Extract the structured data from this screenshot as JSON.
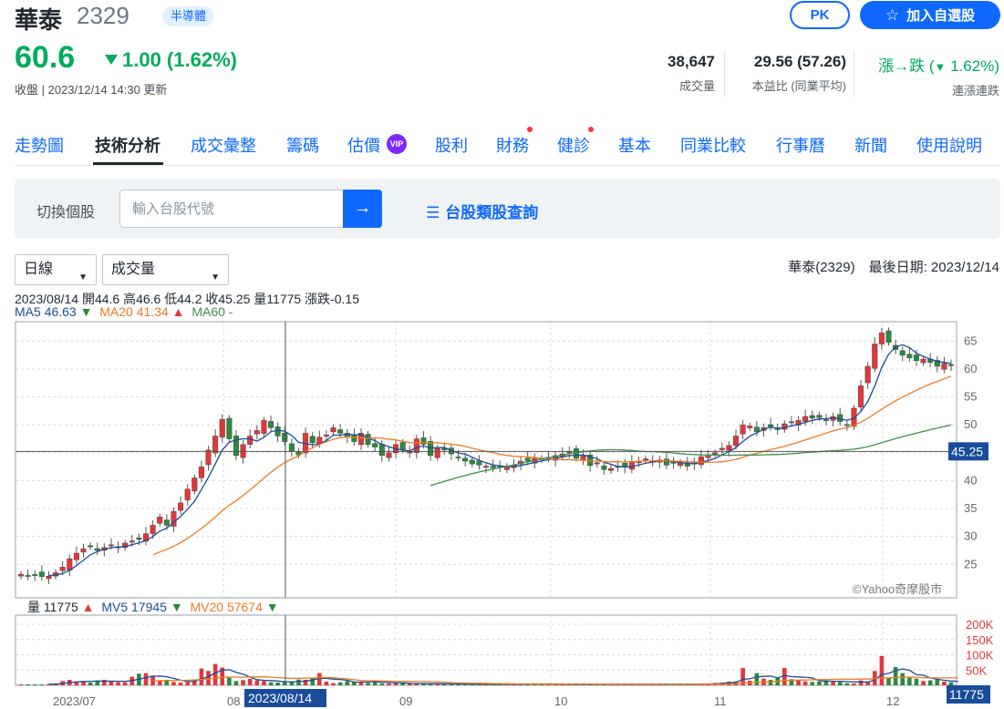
{
  "header": {
    "stock_name": "華泰",
    "stock_code": "2329",
    "industry": "半導體",
    "price": "60.6",
    "change": "1.00 (1.62%)",
    "close_time": "收盤 | 2023/12/14 14:30 更新",
    "pk_label": "PK",
    "watchlist_label": "加入自選股",
    "stats": [
      {
        "value": "38,647",
        "label": "成交量"
      },
      {
        "value": "29.56 (57.26)",
        "label": "本益比 (同業平均)"
      },
      {
        "value": "漲→跌 (",
        "value2": "1.62%)",
        "label": "連漲連跌"
      }
    ]
  },
  "tabs": [
    "走勢圖",
    "技術分析",
    "成交彙整",
    "籌碼",
    "估價",
    "股利",
    "財務",
    "健診",
    "基本",
    "同業比較",
    "行事曆",
    "新聞",
    "使用說明"
  ],
  "vip_label": "VIP",
  "switch": {
    "label": "切換個股",
    "placeholder": "輸入台股代號",
    "go_icon": "→",
    "category_link": "台股類股查詢"
  },
  "selects": {
    "period": "日線",
    "indicator": "成交量"
  },
  "chart_meta": "華泰(2329)　最後日期: 2023/12/14",
  "ohlc_info": "2023/08/14 開44.6 高46.6 低44.2 收45.25 量11775 漲跌-0.15",
  "ma_info": {
    "ma5_label": "MA5",
    "ma5_value": "46.63",
    "ma5_dir": "▼",
    "ma20_label": "MA20",
    "ma20_value": "41.34",
    "ma20_dir": "▲",
    "ma60_label": "MA60",
    "ma60_value": "-"
  },
  "vol_info": {
    "vol_label": "量",
    "vol_value": "11775",
    "vol_dir": "▲",
    "mv5_label": "MV5",
    "mv5_value": "17945",
    "mv5_dir": "▼",
    "mv20_label": "MV20",
    "mv20_value": "57674",
    "mv20_dir": "▼"
  },
  "colors": {
    "up": "#e0383a",
    "down": "#2b8a3e",
    "ma5": "#1a4c9c",
    "ma20": "#ef7a20",
    "ma60": "#3e8f4d",
    "accent": "#0f69ff"
  },
  "chart_data": {
    "type": "candlestick",
    "price_yticks": [
      25,
      30,
      35,
      40,
      45,
      50,
      55,
      60,
      65
    ],
    "volume_yticks": [
      "50K",
      "100K",
      "150K",
      "200K"
    ],
    "x_ticks": [
      "2023/07",
      "08",
      "09",
      "10",
      "11",
      "12"
    ],
    "crosshair_date": "2023/08/14",
    "crosshair_price": "45.25",
    "crosshair_volume": "11775",
    "watermark": "©Yahoo奇摩股市",
    "close": [
      23.2,
      23.0,
      23.1,
      22.8,
      22.9,
      23.5,
      24.5,
      26.0,
      27.0,
      27.8,
      28.2,
      27.5,
      28.0,
      28.5,
      28.2,
      28.8,
      29.2,
      29.5,
      30.5,
      32.0,
      33.5,
      32.0,
      34.5,
      36.0,
      38.5,
      40.5,
      42.5,
      45.5,
      48.0,
      51.0,
      47.5,
      44.5,
      46.5,
      48.0,
      49.0,
      50.8,
      49.5,
      48.0,
      47.0,
      45.25,
      44.6,
      48.5,
      46.8,
      47.8,
      48.2,
      49.5,
      48.5,
      47.8,
      47.0,
      48.5,
      46.5,
      46.0,
      44.5,
      45.0,
      46.5,
      45.5,
      45.2,
      47.5,
      46.5,
      44.5,
      45.8,
      45.5,
      44.8,
      44.2,
      43.5,
      43.0,
      42.8,
      42.6,
      42.3,
      42.5,
      42.5,
      42.8,
      43.5,
      43.5,
      44.0,
      43.8,
      44.2,
      44.5,
      44.8,
      45.2,
      44.0,
      44.6,
      42.7,
      43.2,
      42.0,
      42.2,
      42.6,
      42.4,
      43.4,
      43.4,
      43.9,
      43.5,
      43.7,
      42.8,
      43.1,
      43.2,
      42.6,
      43.4,
      44.3,
      44.6,
      45.0,
      45.8,
      46.3,
      48.0,
      50.0,
      49.8,
      48.8,
      49.5,
      49.7,
      49.2,
      50.2,
      50.5,
      50.8,
      51.5,
      51.2,
      51.3,
      50.8,
      51.5,
      50.6,
      49.9,
      53.0,
      57.0,
      60.5,
      64.5,
      66.5,
      64.8,
      63.5,
      62.5,
      62.0,
      61.5,
      61.8,
      61.2,
      60.5,
      61.0,
      60.6
    ],
    "volume": [
      3,
      3,
      3,
      3,
      4,
      6,
      14,
      18,
      13,
      12,
      9,
      16,
      18,
      12,
      10,
      10,
      28,
      38,
      40,
      32,
      15,
      16,
      11,
      9,
      10,
      19,
      55,
      47,
      70,
      58,
      25,
      14,
      17,
      21,
      16,
      14,
      10,
      9,
      11,
      11.8,
      19,
      18,
      25,
      40,
      12,
      7,
      10,
      14,
      10,
      12,
      8,
      14,
      6,
      6,
      7,
      6,
      6,
      5,
      6,
      4,
      6,
      4,
      4,
      4,
      4,
      3,
      4,
      4,
      3,
      4,
      4,
      4,
      4,
      6,
      5,
      4,
      4,
      3,
      4,
      4,
      5,
      4,
      4,
      3,
      3,
      4,
      4,
      3,
      3,
      4,
      3,
      4,
      4,
      3,
      4,
      3,
      3,
      4,
      5,
      6,
      8,
      9,
      12,
      13,
      57,
      15,
      40,
      22,
      18,
      25,
      57,
      20,
      18,
      13,
      11,
      12,
      16,
      15,
      11,
      7,
      6,
      16,
      13,
      47,
      96,
      24,
      60,
      40,
      28,
      22,
      14,
      16,
      18,
      12,
      10,
      8
    ]
  }
}
